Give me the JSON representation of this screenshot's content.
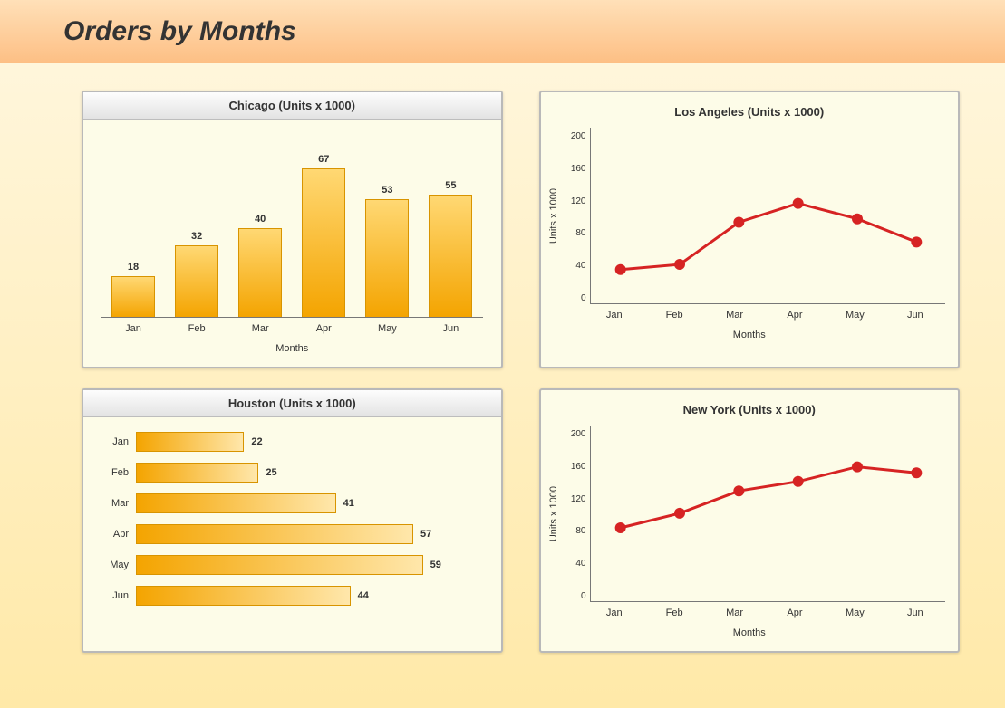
{
  "page_title": "Orders by Months",
  "x_axis_label": "Months",
  "y_axis_label": "Units x 1000",
  "chart_data": [
    {
      "id": "chicago",
      "type": "bar",
      "orientation": "vertical",
      "title": "Chicago (Units x 1000)",
      "categories": [
        "Jan",
        "Feb",
        "Mar",
        "Apr",
        "May",
        "Jun"
      ],
      "values": [
        18,
        32,
        40,
        67,
        53,
        55
      ],
      "xlabel": "Months",
      "ylabel": "",
      "ylim": [
        0,
        70
      ]
    },
    {
      "id": "los_angeles",
      "type": "line",
      "title": "Los Angeles (Units x 1000)",
      "categories": [
        "Jan",
        "Feb",
        "Mar",
        "Apr",
        "May",
        "Jun"
      ],
      "values": [
        35,
        41,
        90,
        112,
        94,
        67
      ],
      "xlabel": "Months",
      "ylabel": "Units x 1000",
      "ylim": [
        0,
        200
      ],
      "yticks": [
        0,
        40,
        80,
        120,
        160,
        200
      ]
    },
    {
      "id": "houston",
      "type": "bar",
      "orientation": "horizontal",
      "title": "Houston (Units x 1000)",
      "categories": [
        "Jan",
        "Feb",
        "Mar",
        "Apr",
        "May",
        "Jun"
      ],
      "values": [
        22,
        25,
        41,
        57,
        59,
        44
      ],
      "xlabel": "",
      "ylabel": "",
      "xlim": [
        0,
        60
      ]
    },
    {
      "id": "new_york",
      "type": "line",
      "title": "New York (Units x 1000)",
      "categories": [
        "Jan",
        "Feb",
        "Mar",
        "Apr",
        "May",
        "Jun"
      ],
      "values": [
        81,
        98,
        124,
        135,
        152,
        145
      ],
      "xlabel": "Months",
      "ylabel": "Units x 1000",
      "ylim": [
        0,
        200
      ],
      "yticks": [
        0,
        40,
        80,
        120,
        160,
        200
      ]
    }
  ],
  "colors": {
    "bar_fill_top": "#ffd873",
    "bar_fill_bottom": "#f4a400",
    "line": "#d62323",
    "panel_bg": "#fdfce8",
    "header_bg": "#fdbf84"
  }
}
